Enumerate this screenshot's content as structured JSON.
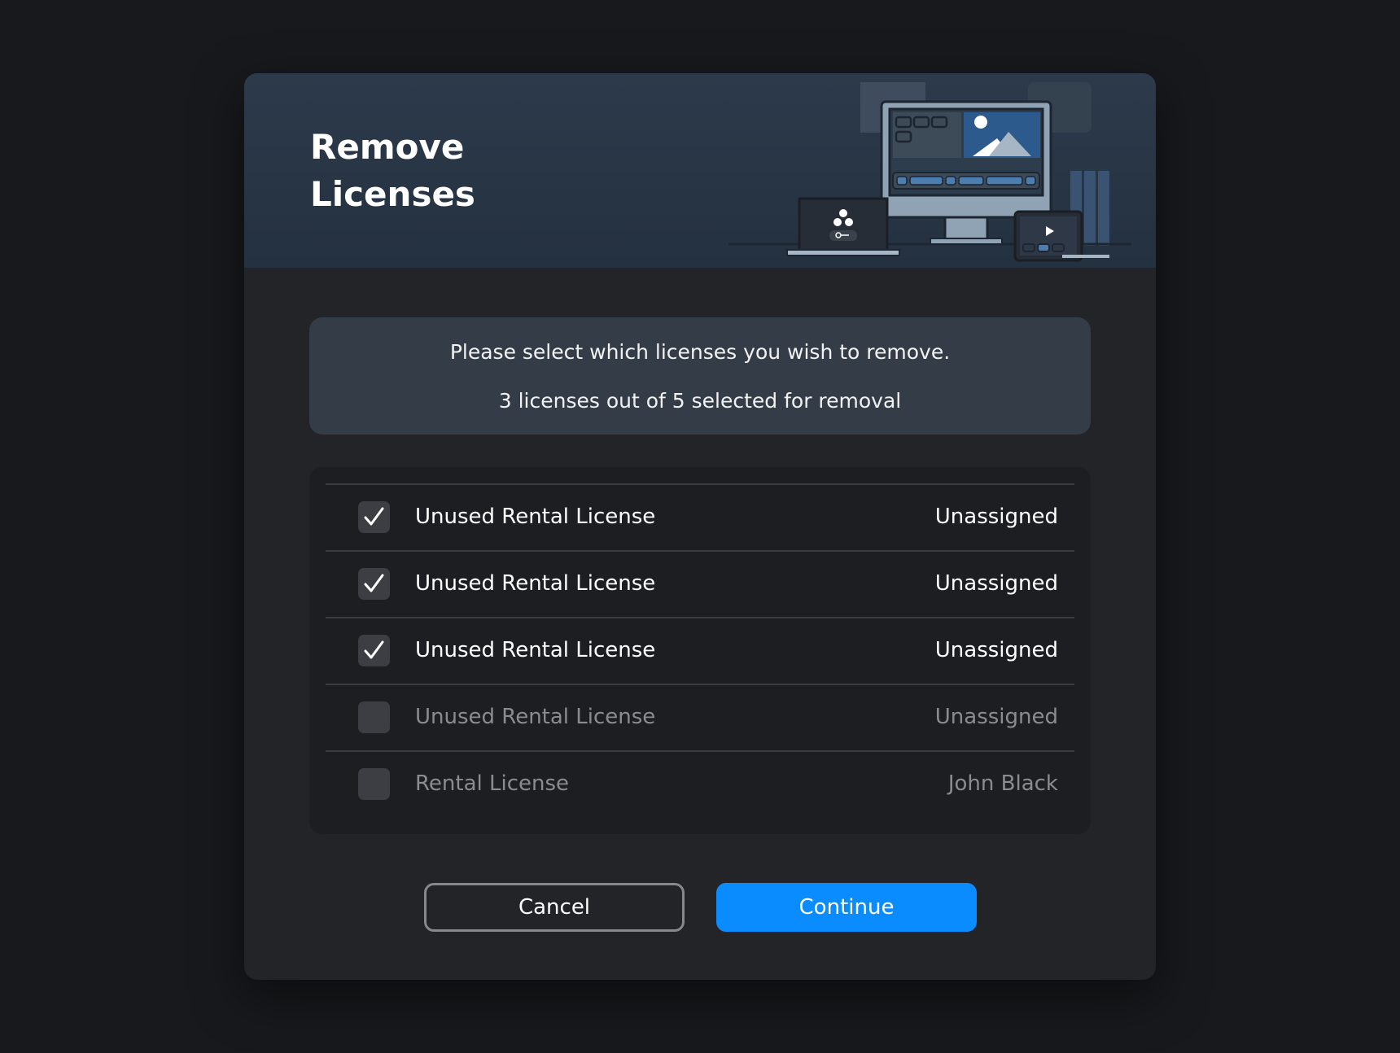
{
  "dialog": {
    "title": "Remove Licenses",
    "info": {
      "line1": "Please select which licenses you wish to remove.",
      "line2": "3 licenses out of 5 selected for removal"
    },
    "licenses": [
      {
        "name": "Unused Rental License",
        "assigned": "Unassigned",
        "checked": true
      },
      {
        "name": "Unused Rental License",
        "assigned": "Unassigned",
        "checked": true
      },
      {
        "name": "Unused Rental License",
        "assigned": "Unassigned",
        "checked": true
      },
      {
        "name": "Unused Rental License",
        "assigned": "Unassigned",
        "checked": false
      },
      {
        "name": "Rental License",
        "assigned": "John Black",
        "checked": false
      }
    ],
    "buttons": {
      "cancel": "Cancel",
      "continue": "Continue"
    }
  },
  "colors": {
    "accent": "#0a8cff",
    "background": "#18191c",
    "dialog": "#222428"
  },
  "icons": {
    "checkmark": "checkmark-icon",
    "illustration": "devices-illustration"
  }
}
